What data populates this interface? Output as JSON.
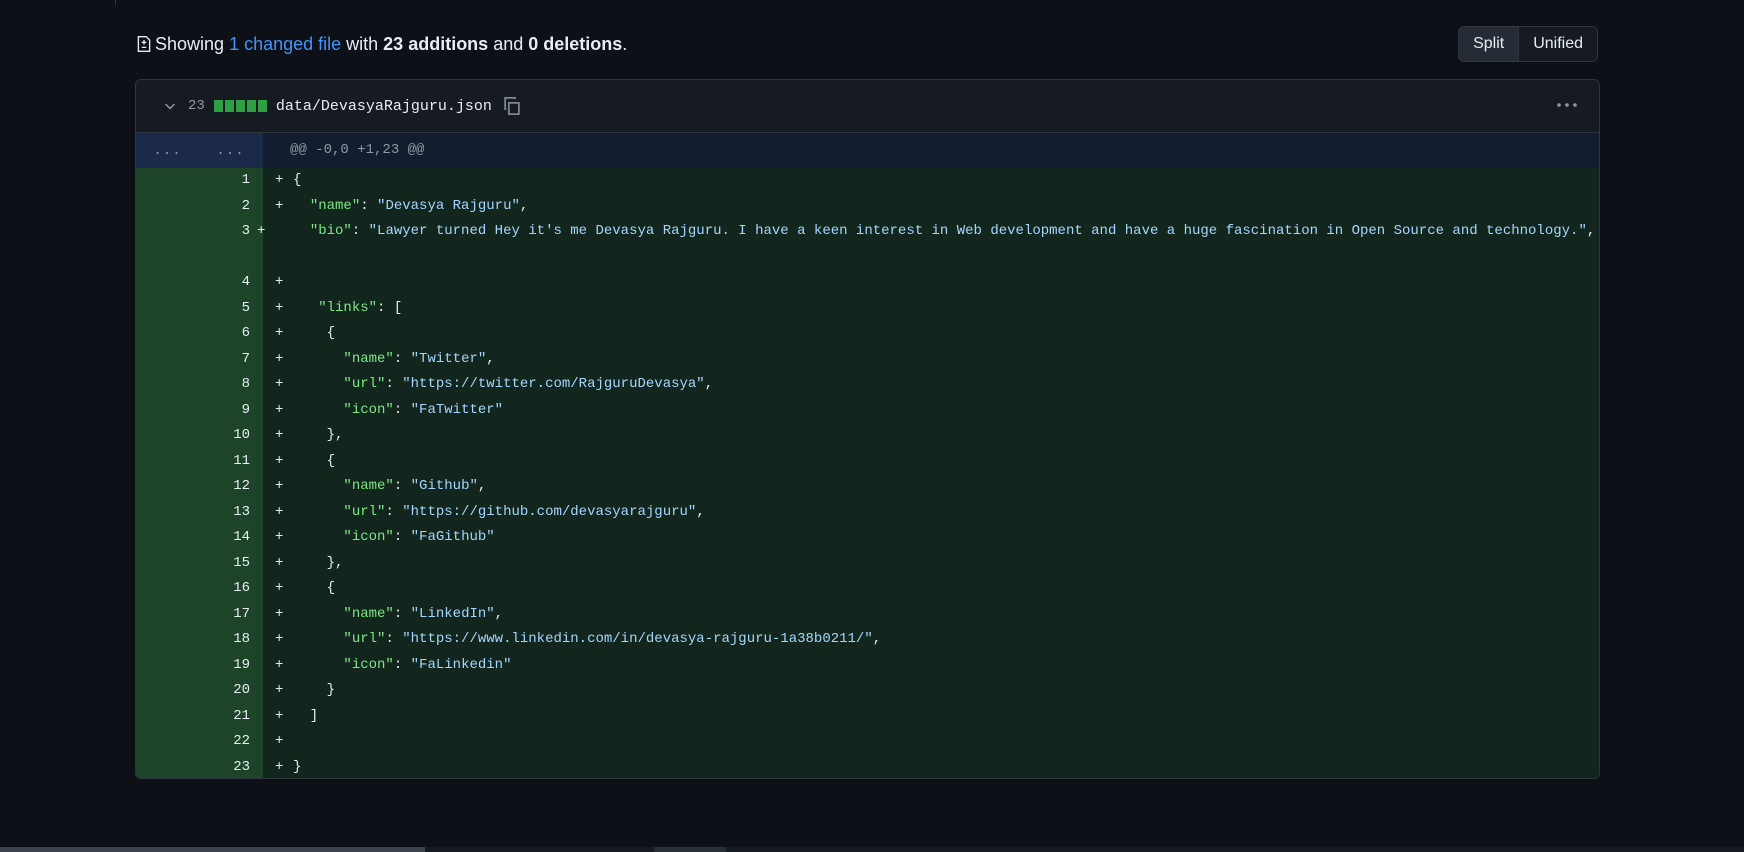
{
  "summary": {
    "prefix": "Showing ",
    "changed_link": "1 changed file",
    "with": " with ",
    "additions": "23 additions",
    "and": " and ",
    "deletions": "0 deletions",
    "suffix": "."
  },
  "view_toggle": {
    "split_label": "Split",
    "unified_label": "Unified",
    "selected": "Split"
  },
  "file": {
    "change_count": "23",
    "diffstat_blocks": 5,
    "path": "data/DevasyaRajguru.json",
    "hunk": {
      "left_gutter": "...",
      "right_gutter": "...",
      "header": "@@ -0,0 +1,23 @@"
    },
    "lines": [
      {
        "num": "1",
        "text": "{"
      },
      {
        "num": "2",
        "text": "  \"name\": \"Devasya Rajguru\","
      },
      {
        "num": "3",
        "text": "  \"bio\": \"Lawyer turned Hey it's me Devasya Rajguru. I have a keen interest in Web development and have a huge fascination in Open Source and technology.\","
      },
      {
        "num": "4",
        "text": ""
      },
      {
        "num": "5",
        "text": "   \"links\": ["
      },
      {
        "num": "6",
        "text": "    {"
      },
      {
        "num": "7",
        "text": "      \"name\": \"Twitter\","
      },
      {
        "num": "8",
        "text": "      \"url\": \"https://twitter.com/RajguruDevasya\","
      },
      {
        "num": "9",
        "text": "      \"icon\": \"FaTwitter\""
      },
      {
        "num": "10",
        "text": "    },"
      },
      {
        "num": "11",
        "text": "    {"
      },
      {
        "num": "12",
        "text": "      \"name\": \"Github\","
      },
      {
        "num": "13",
        "text": "      \"url\": \"https://github.com/devasyarajguru\","
      },
      {
        "num": "14",
        "text": "      \"icon\": \"FaGithub\""
      },
      {
        "num": "15",
        "text": "    },"
      },
      {
        "num": "16",
        "text": "    {"
      },
      {
        "num": "17",
        "text": "      \"name\": \"LinkedIn\","
      },
      {
        "num": "18",
        "text": "      \"url\": \"https://www.linkedin.com/in/devasya-rajguru-1a38b0211/\","
      },
      {
        "num": "19",
        "text": "      \"icon\": \"FaLinkedin\""
      },
      {
        "num": "20",
        "text": "    }"
      },
      {
        "num": "21",
        "text": "  ]"
      },
      {
        "num": "22",
        "text": ""
      },
      {
        "num": "23",
        "text": "}"
      }
    ]
  },
  "icons": {
    "file_diff": "file-diff-icon",
    "chevron": "chevron-down-icon",
    "copy": "copy-icon",
    "kebab": "kebab-horizontal-icon"
  },
  "colors": {
    "background": "#0d1117",
    "addition_gutter": "#1d4428",
    "addition_code": "#12261e",
    "diffstat_green": "#2ea043",
    "link_blue": "#4493f8",
    "json_key": "#7ee787",
    "json_string": "#a5d6ff"
  }
}
